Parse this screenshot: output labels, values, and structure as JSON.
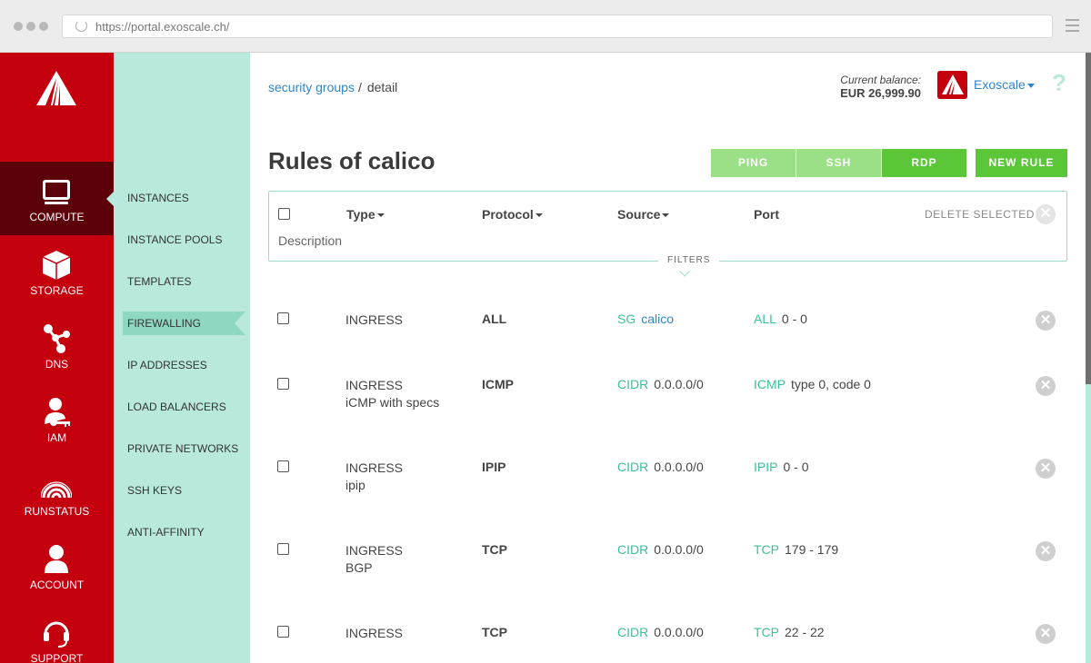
{
  "browser": {
    "url": "https://portal.exoscale.ch/"
  },
  "nav": {
    "items": [
      {
        "label": "COMPUTE",
        "icon": "monitor-icon",
        "active": true
      },
      {
        "label": "STORAGE",
        "icon": "cube-icon",
        "active": false
      },
      {
        "label": "DNS",
        "icon": "dns-network-icon",
        "active": false
      },
      {
        "label": "IAM",
        "icon": "user-key-icon",
        "active": false
      },
      {
        "label": "RUNSTATUS",
        "icon": "signal-waves-icon",
        "active": false
      },
      {
        "label": "ACCOUNT",
        "icon": "person-icon",
        "active": false
      },
      {
        "label": "SUPPORT",
        "icon": "headset-icon",
        "active": false
      }
    ]
  },
  "subnav": {
    "items": [
      {
        "label": "INSTANCES"
      },
      {
        "label": "INSTANCE POOLS"
      },
      {
        "label": "TEMPLATES"
      },
      {
        "label": "FIREWALLING",
        "active": true
      },
      {
        "label": "IP ADDRESSES"
      },
      {
        "label": "LOAD BALANCERS"
      },
      {
        "label": "PRIVATE NETWORKS"
      },
      {
        "label": "SSH KEYS"
      },
      {
        "label": "ANTI-AFFINITY"
      }
    ]
  },
  "breadcrumb": {
    "parent": "security groups",
    "separator": "/",
    "current": "detail"
  },
  "account": {
    "balance_caption": "Current balance:",
    "balance": "EUR 26,999.90",
    "org": "Exoscale",
    "help": "?"
  },
  "page": {
    "title": "Rules of calico"
  },
  "actions": {
    "ping": "PING",
    "ssh": "SSH",
    "rdp": "RDP",
    "new_rule": "NEW RULE"
  },
  "table": {
    "headers": {
      "type": "Type",
      "protocol": "Protocol",
      "source": "Source",
      "port": "Port",
      "description": "Description"
    },
    "delete_selected": "DELETE SELECTED",
    "filters": "FILTERS",
    "rows": [
      {
        "type": "INGRESS",
        "desc": "",
        "protocol": "ALL",
        "source_kind": "SG",
        "source_val": "calico",
        "port_kind": "ALL",
        "port_val": "0 - 0"
      },
      {
        "type": "INGRESS",
        "desc": "iCMP with specs",
        "protocol": "ICMP",
        "source_kind": "CIDR",
        "source_val": "0.0.0.0/0",
        "port_kind": "ICMP",
        "port_val": "type 0, code 0"
      },
      {
        "type": "INGRESS",
        "desc": "ipip",
        "protocol": "IPIP",
        "source_kind": "CIDR",
        "source_val": "0.0.0.0/0",
        "port_kind": "IPIP",
        "port_val": "0 - 0"
      },
      {
        "type": "INGRESS",
        "desc": "BGP",
        "protocol": "TCP",
        "source_kind": "CIDR",
        "source_val": "0.0.0.0/0",
        "port_kind": "TCP",
        "port_val": "179 - 179"
      },
      {
        "type": "INGRESS",
        "desc": "",
        "protocol": "TCP",
        "source_kind": "CIDR",
        "source_val": "0.0.0.0/0",
        "port_kind": "TCP",
        "port_val": "22 - 22"
      }
    ]
  },
  "colors": {
    "brand_red": "#c4000f",
    "mint": "#b9e8dc",
    "green": "#5cc639",
    "link_blue": "#2f86c9",
    "teal": "#3cbf9a"
  }
}
